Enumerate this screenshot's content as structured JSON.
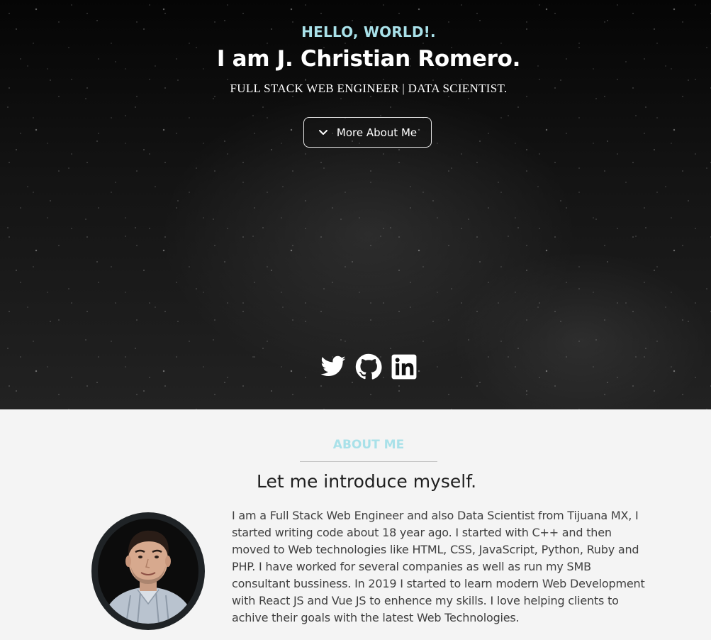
{
  "hero": {
    "greeting": "HELLO, WORLD!.",
    "name": "I am J. Christian Romero.",
    "subtitle": "FULL STACK WEB ENGINEER | DATA SCIENTIST.",
    "button_label": "More About Me",
    "button_icon": "chevron-down-icon",
    "socials": [
      {
        "name": "Twitter",
        "icon": "twitter-icon"
      },
      {
        "name": "GitHub",
        "icon": "github-icon"
      },
      {
        "name": "LinkedIn",
        "icon": "linkedin-icon"
      }
    ]
  },
  "about": {
    "label": "ABOUT ME",
    "heading": "Let me introduce myself.",
    "text": "I am a Full Stack Web Engineer and also Data Scientist from Tijuana MX, I started writing code about 18 year ago. I started with C++ and then moved to Web technologies like HTML, CSS, JavaScript, Python, Ruby and PHP. I have worked for several companies as well as run my SMB consultant bussiness. In 2019 I started to learn modern Web Development with React JS and Vue JS to enhence my skills. I love helping clients to achive their goals with the latest Web Technologies.",
    "avatar": "profile-photo"
  },
  "colors": {
    "accent": "#a9e1e9",
    "hero_text": "#ffffff",
    "about_bg": "#f4f4f4",
    "body_text": "#3f3f3f",
    "heading_text": "#1e1e1e"
  }
}
